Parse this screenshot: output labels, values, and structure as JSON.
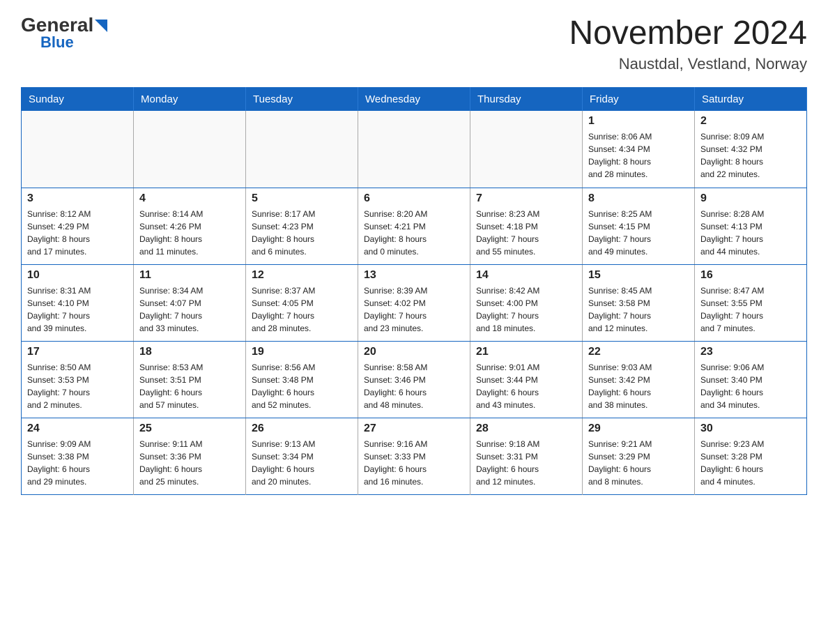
{
  "header": {
    "logo_general": "General",
    "logo_blue": "Blue",
    "main_title": "November 2024",
    "subtitle": "Naustdal, Vestland, Norway"
  },
  "calendar": {
    "days_of_week": [
      "Sunday",
      "Monday",
      "Tuesday",
      "Wednesday",
      "Thursday",
      "Friday",
      "Saturday"
    ],
    "weeks": [
      [
        {
          "day": "",
          "info": ""
        },
        {
          "day": "",
          "info": ""
        },
        {
          "day": "",
          "info": ""
        },
        {
          "day": "",
          "info": ""
        },
        {
          "day": "",
          "info": ""
        },
        {
          "day": "1",
          "info": "Sunrise: 8:06 AM\nSunset: 4:34 PM\nDaylight: 8 hours\nand 28 minutes."
        },
        {
          "day": "2",
          "info": "Sunrise: 8:09 AM\nSunset: 4:32 PM\nDaylight: 8 hours\nand 22 minutes."
        }
      ],
      [
        {
          "day": "3",
          "info": "Sunrise: 8:12 AM\nSunset: 4:29 PM\nDaylight: 8 hours\nand 17 minutes."
        },
        {
          "day": "4",
          "info": "Sunrise: 8:14 AM\nSunset: 4:26 PM\nDaylight: 8 hours\nand 11 minutes."
        },
        {
          "day": "5",
          "info": "Sunrise: 8:17 AM\nSunset: 4:23 PM\nDaylight: 8 hours\nand 6 minutes."
        },
        {
          "day": "6",
          "info": "Sunrise: 8:20 AM\nSunset: 4:21 PM\nDaylight: 8 hours\nand 0 minutes."
        },
        {
          "day": "7",
          "info": "Sunrise: 8:23 AM\nSunset: 4:18 PM\nDaylight: 7 hours\nand 55 minutes."
        },
        {
          "day": "8",
          "info": "Sunrise: 8:25 AM\nSunset: 4:15 PM\nDaylight: 7 hours\nand 49 minutes."
        },
        {
          "day": "9",
          "info": "Sunrise: 8:28 AM\nSunset: 4:13 PM\nDaylight: 7 hours\nand 44 minutes."
        }
      ],
      [
        {
          "day": "10",
          "info": "Sunrise: 8:31 AM\nSunset: 4:10 PM\nDaylight: 7 hours\nand 39 minutes."
        },
        {
          "day": "11",
          "info": "Sunrise: 8:34 AM\nSunset: 4:07 PM\nDaylight: 7 hours\nand 33 minutes."
        },
        {
          "day": "12",
          "info": "Sunrise: 8:37 AM\nSunset: 4:05 PM\nDaylight: 7 hours\nand 28 minutes."
        },
        {
          "day": "13",
          "info": "Sunrise: 8:39 AM\nSunset: 4:02 PM\nDaylight: 7 hours\nand 23 minutes."
        },
        {
          "day": "14",
          "info": "Sunrise: 8:42 AM\nSunset: 4:00 PM\nDaylight: 7 hours\nand 18 minutes."
        },
        {
          "day": "15",
          "info": "Sunrise: 8:45 AM\nSunset: 3:58 PM\nDaylight: 7 hours\nand 12 minutes."
        },
        {
          "day": "16",
          "info": "Sunrise: 8:47 AM\nSunset: 3:55 PM\nDaylight: 7 hours\nand 7 minutes."
        }
      ],
      [
        {
          "day": "17",
          "info": "Sunrise: 8:50 AM\nSunset: 3:53 PM\nDaylight: 7 hours\nand 2 minutes."
        },
        {
          "day": "18",
          "info": "Sunrise: 8:53 AM\nSunset: 3:51 PM\nDaylight: 6 hours\nand 57 minutes."
        },
        {
          "day": "19",
          "info": "Sunrise: 8:56 AM\nSunset: 3:48 PM\nDaylight: 6 hours\nand 52 minutes."
        },
        {
          "day": "20",
          "info": "Sunrise: 8:58 AM\nSunset: 3:46 PM\nDaylight: 6 hours\nand 48 minutes."
        },
        {
          "day": "21",
          "info": "Sunrise: 9:01 AM\nSunset: 3:44 PM\nDaylight: 6 hours\nand 43 minutes."
        },
        {
          "day": "22",
          "info": "Sunrise: 9:03 AM\nSunset: 3:42 PM\nDaylight: 6 hours\nand 38 minutes."
        },
        {
          "day": "23",
          "info": "Sunrise: 9:06 AM\nSunset: 3:40 PM\nDaylight: 6 hours\nand 34 minutes."
        }
      ],
      [
        {
          "day": "24",
          "info": "Sunrise: 9:09 AM\nSunset: 3:38 PM\nDaylight: 6 hours\nand 29 minutes."
        },
        {
          "day": "25",
          "info": "Sunrise: 9:11 AM\nSunset: 3:36 PM\nDaylight: 6 hours\nand 25 minutes."
        },
        {
          "day": "26",
          "info": "Sunrise: 9:13 AM\nSunset: 3:34 PM\nDaylight: 6 hours\nand 20 minutes."
        },
        {
          "day": "27",
          "info": "Sunrise: 9:16 AM\nSunset: 3:33 PM\nDaylight: 6 hours\nand 16 minutes."
        },
        {
          "day": "28",
          "info": "Sunrise: 9:18 AM\nSunset: 3:31 PM\nDaylight: 6 hours\nand 12 minutes."
        },
        {
          "day": "29",
          "info": "Sunrise: 9:21 AM\nSunset: 3:29 PM\nDaylight: 6 hours\nand 8 minutes."
        },
        {
          "day": "30",
          "info": "Sunrise: 9:23 AM\nSunset: 3:28 PM\nDaylight: 6 hours\nand 4 minutes."
        }
      ]
    ]
  }
}
